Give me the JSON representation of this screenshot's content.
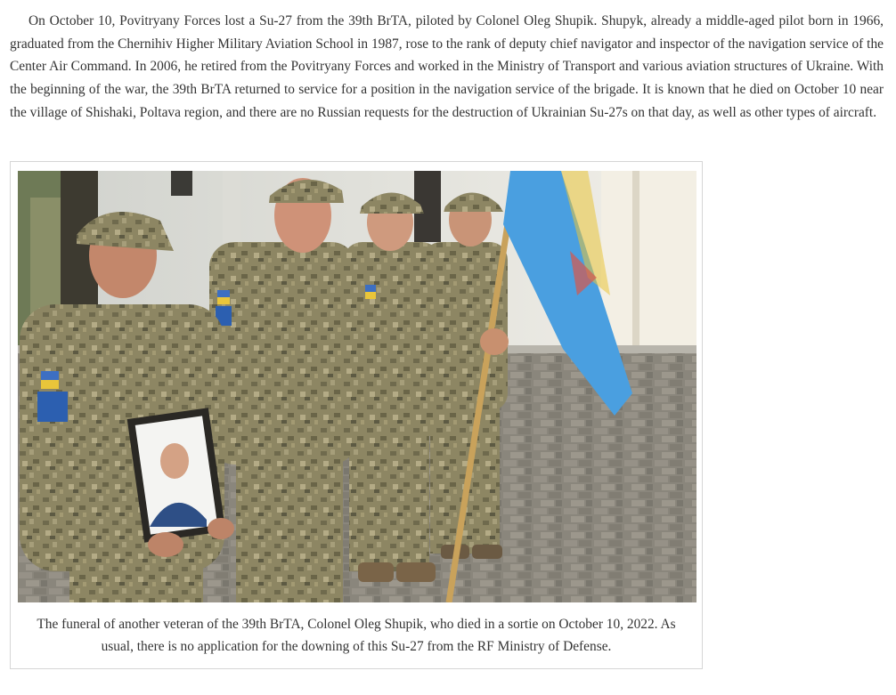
{
  "article": {
    "paragraph": "On October 10, Povitryany Forces lost a Su-27 from the 39th BrTA, piloted by Colonel Oleg Shupik. Shupyk, already a middle-aged pilot born in 1966, graduated from the Chernihiv Higher Military Aviation School in 1987, rose to the rank of deputy chief navigator and inspector of the navigation service of the Center Air Command. In 2006, he retired from the Povitryany Forces and worked in the Ministry of Transport and various aviation structures of Ukraine. With the beginning of the war, the 39th BrTA returned to service for a position in the navigation service of the brigade. It is known that he died on October 10 near the village of Shishaki, Poltava region, and there are no Russian requests for the destruction of Ukrainian Su-27s on that day, as well as other types of aircraft."
  },
  "figure": {
    "caption": "The funeral of another veteran of the 39th BrTA, Colonel Oleg Shupik, who died in a sortie on October 10, 2022. As usual, there is no application for the downing of this Su-27 from the RF Ministry of Defense."
  },
  "colors": {
    "text": "#333333",
    "figure_border": "#d6d6d6",
    "camouflage": "#8b8560",
    "flag_blue": "#4a9fe0",
    "pavement": "#8f8a80"
  }
}
